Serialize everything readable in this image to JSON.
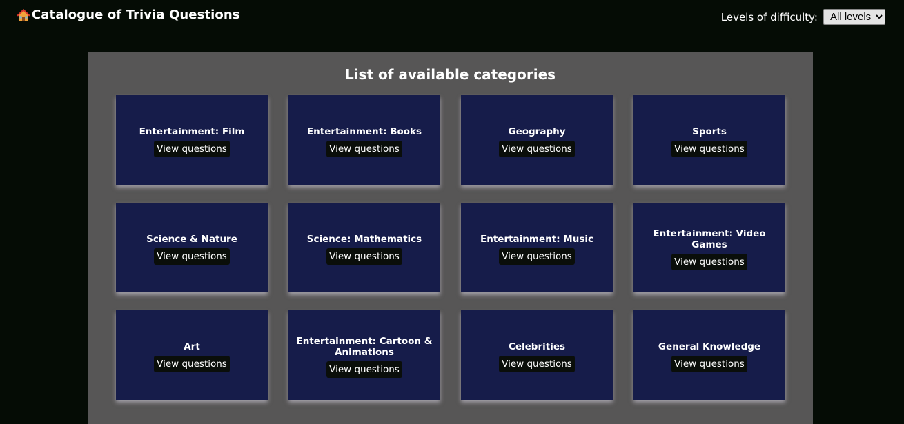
{
  "header": {
    "title": "Catalogue of Trivia Questions",
    "difficulty_label": "Levels of difficulty:",
    "difficulty_selected": "All levels"
  },
  "main": {
    "title": "List of available categories",
    "categories": [
      {
        "name": "Entertainment: Film",
        "button": "View questions"
      },
      {
        "name": "Entertainment: Books",
        "button": "View questions"
      },
      {
        "name": "Geography",
        "button": "View questions"
      },
      {
        "name": "Sports",
        "button": "View questions"
      },
      {
        "name": "Science & Nature",
        "button": "View questions"
      },
      {
        "name": "Science: Mathematics",
        "button": "View questions"
      },
      {
        "name": "Entertainment: Music",
        "button": "View questions"
      },
      {
        "name": "Entertainment: Video Games",
        "button": "View questions"
      },
      {
        "name": "Art",
        "button": "View questions"
      },
      {
        "name": "Entertainment: Cartoon & Animations",
        "button": "View questions"
      },
      {
        "name": "Celebrities",
        "button": "View questions"
      },
      {
        "name": "General Knowledge",
        "button": "View questions"
      }
    ]
  },
  "colors": {
    "background": "#050c05",
    "panel": "#575656",
    "card": "#161c4a",
    "button": "#0a0e0a"
  },
  "icons": {
    "brand": "house-icon",
    "select": "chevron-down-icon"
  }
}
